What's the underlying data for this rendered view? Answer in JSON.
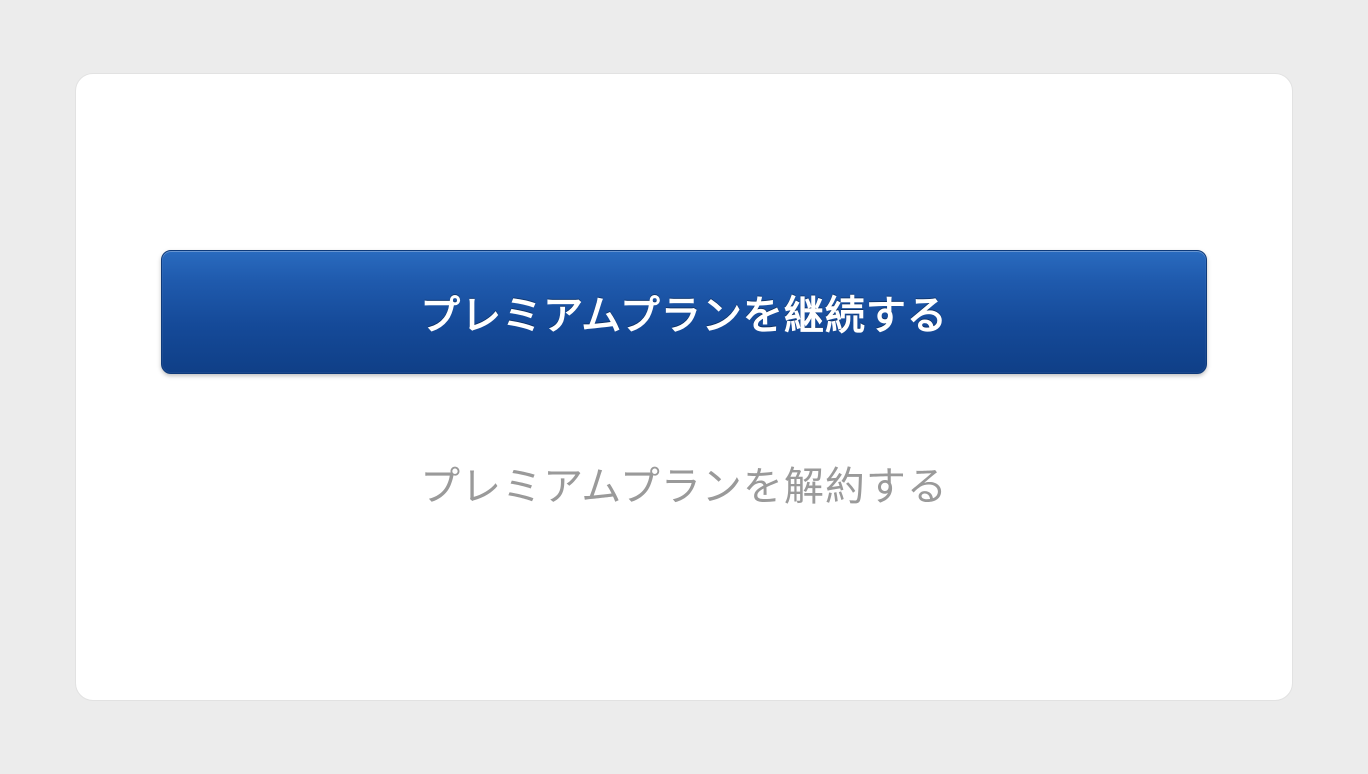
{
  "actions": {
    "continue_label": "プレミアムプランを継続する",
    "cancel_label": "プレミアムプランを解約する"
  }
}
